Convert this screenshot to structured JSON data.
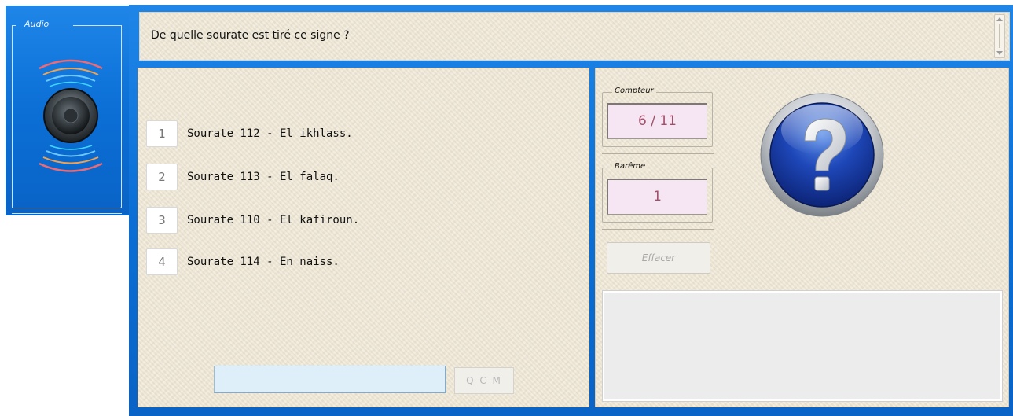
{
  "audio": {
    "legend": "Audio",
    "icon": "speaker-icon"
  },
  "question": {
    "text": "De quelle sourate est tiré ce signe ?"
  },
  "answers": [
    {
      "number": "1",
      "label": "Sourate 112 - El ikhlass."
    },
    {
      "number": "2",
      "label": "Sourate 113 - El falaq."
    },
    {
      "number": "3",
      "label": "Sourate 110 - El kafiroun."
    },
    {
      "number": "4",
      "label": "Sourate 114 - En naiss."
    }
  ],
  "answer_input": {
    "value": ""
  },
  "qcm_button": {
    "label": "Q C M"
  },
  "compteur": {
    "legend": "Compteur",
    "value": "6 / 11"
  },
  "bareme": {
    "legend": "Barême",
    "value": "1"
  },
  "effacer_button": {
    "label": "Effacer"
  },
  "help": {
    "icon": "question-mark-icon"
  },
  "colors": {
    "frame_blue": "#0b6fd6",
    "paper": "#efe7d5",
    "value_bg": "#f6e6f3",
    "value_text": "#a1506a"
  }
}
